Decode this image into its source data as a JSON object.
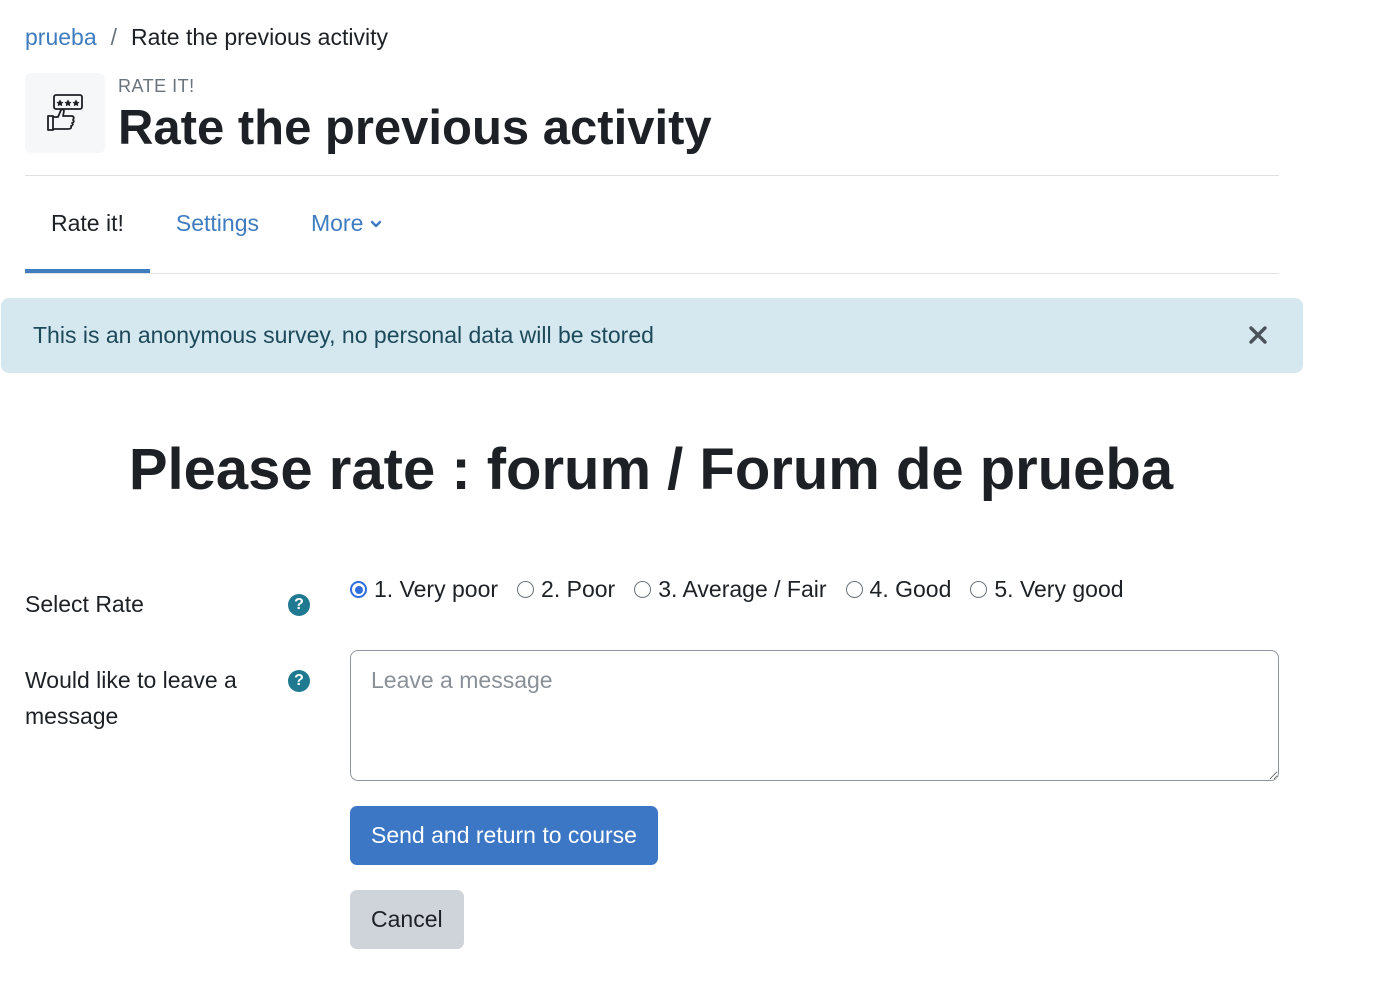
{
  "breadcrumb": {
    "course": "prueba",
    "separator": "/",
    "current": "Rate the previous activity"
  },
  "header": {
    "activity_icon": "thumbs-up-stars-icon",
    "activity_type": "RATE IT!",
    "title": "Rate the previous activity"
  },
  "tabs": [
    {
      "label": "Rate it!",
      "active": true
    },
    {
      "label": "Settings",
      "active": false
    },
    {
      "label": "More",
      "active": false,
      "icon": "chevron-down-icon"
    }
  ],
  "alert": {
    "message": "This is an anonymous survey, no personal data will be stored",
    "close_icon": "close-icon"
  },
  "heading": "Please rate : forum / Forum de prueba",
  "form": {
    "select_rate_label": "Select Rate",
    "options": [
      {
        "label": "1. Very poor",
        "checked": true
      },
      {
        "label": "2. Poor",
        "checked": false
      },
      {
        "label": "3. Average / Fair",
        "checked": false
      },
      {
        "label": "4. Good",
        "checked": false
      },
      {
        "label": "5. Very good",
        "checked": false
      }
    ],
    "message_label": "Would like to leave a message",
    "message_placeholder": "Leave a message",
    "message_value": "",
    "help_icon": "question-circle-icon",
    "submit_label": "Send and return to course",
    "cancel_label": "Cancel"
  },
  "colors": {
    "link": "#3f7cc0",
    "alert_bg": "#d6e8ef",
    "primary_button": "#3c77c6",
    "secondary_button": "#ced4da",
    "help_icon": "#1f7a91"
  }
}
